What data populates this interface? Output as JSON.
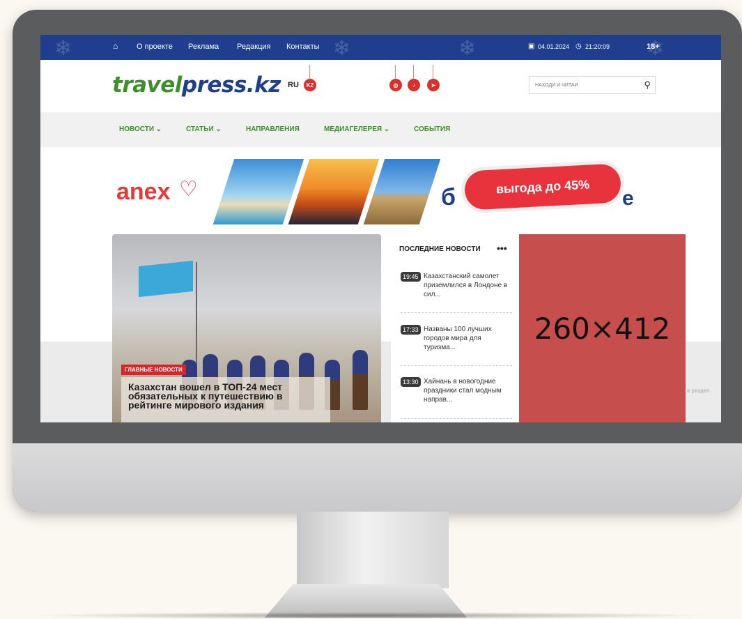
{
  "topbar": {
    "nav": [
      "О проекте",
      "Реклама",
      "Редакция",
      "Контакты"
    ],
    "date": "04.01.2024",
    "time": "21:20:09",
    "age": "18+"
  },
  "header": {
    "logo_part1": "travel",
    "logo_part2": "press.kz",
    "lang_ru": "RU",
    "lang_kz": "KZ",
    "socials": [
      "instagram-icon",
      "tiktok-icon",
      "telegram-icon"
    ],
    "search_placeholder": "НАХОДИ И ЧИТАЙ"
  },
  "nav": {
    "items": [
      "НОВОСТИ ⌄",
      "СТАТЬИ ⌄",
      "НАПРАВЛЕНИЯ",
      "МЕДИАГЕЛЕРЕЯ ⌄",
      "СОБЫТИЯ"
    ]
  },
  "banner": {
    "brand": "anex",
    "promo": "выгода до 45%"
  },
  "hero": {
    "badge": "ГЛАВНЫЕ НОВОСТИ",
    "title": "Казахстан вошел в ТОП-24 мест обязательных к путешествию в рейтинге мирового издания"
  },
  "latest": {
    "title": "ПОСЛЕДНИЕ НОВОСТИ",
    "more": "•••",
    "items": [
      {
        "time": "19:45",
        "text": "Казахстанский самолет приземлился в Лондоне в сил..."
      },
      {
        "time": "17:33",
        "text": "Названы 100 лучших городов мира для туризма..."
      },
      {
        "time": "13:30",
        "text": "Хайнань в новогодние праздники стал модным направ..."
      }
    ]
  },
  "ad": {
    "label": "260×412"
  },
  "side_text": "в раздел",
  "colors": {
    "topbar": "#1f3f8e",
    "brand_green": "#3d8f2b",
    "brand_blue": "#1e3f8c",
    "accent_red": "#d5262c",
    "ad_box": "#c64e4c"
  }
}
